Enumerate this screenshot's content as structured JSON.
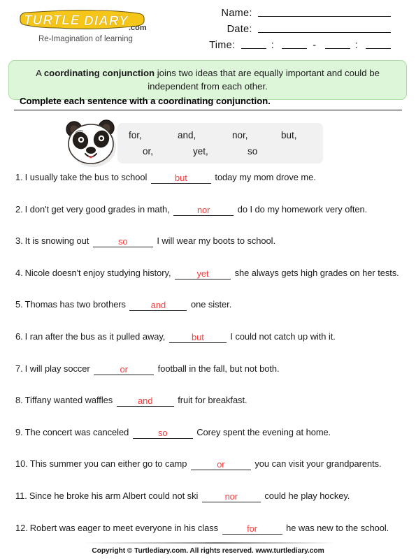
{
  "brand": {
    "logo_line1": "TURTLE",
    "logo_line2": "DIARY",
    "logo_suffix": ".com",
    "tagline": "Re-Imagination of learning",
    "logo_color": "#F5C518",
    "logo_outline": "#3a3a3a"
  },
  "header": {
    "name_label": "Name:",
    "date_label": "Date:",
    "time_label": "Time:",
    "time_colon": ":",
    "time_dash": "-"
  },
  "definition": {
    "prefix": "A ",
    "term": "coordinating conjunction",
    "rest": " joins two ideas that are equally important and could be independent from each other."
  },
  "instruction": {
    "text": "Complete each sentence with a coordinating conjunction."
  },
  "wordbank": {
    "icon": "panda-face-icon",
    "row1": [
      "for,",
      "and,",
      "nor,",
      "but,"
    ],
    "row2": [
      "or,",
      "yet,",
      "so"
    ]
  },
  "answer_color": "#ff3a3a",
  "questions": [
    {
      "num": "1.",
      "before": "I usually take the bus to school",
      "answer": "but",
      "after": "today my mom drove me.",
      "blank_width": 86
    },
    {
      "num": "2.",
      "before": "I don't get very good grades in math,",
      "answer": "nor",
      "after": "do I do my homework very often.",
      "blank_width": 86
    },
    {
      "num": "3.",
      "before": "It is snowing out",
      "answer": "so",
      "after": "I will wear my boots to school.",
      "blank_width": 86
    },
    {
      "num": "4.",
      "before": "Nicole doesn't enjoy studying history,",
      "answer": "yet",
      "after": "she always gets high grades on her tests.",
      "blank_width": 80
    },
    {
      "num": "5.",
      "before": "Thomas has two brothers",
      "answer": "and",
      "after": "one sister.",
      "blank_width": 82
    },
    {
      "num": "6.",
      "before": "I ran after the bus as it pulled away,",
      "answer": "but",
      "after": "I could not catch up with it.",
      "blank_width": 82
    },
    {
      "num": "7.",
      "before": "I will play soccer",
      "answer": "or",
      "after": "football in the fall, but not both.",
      "blank_width": 86
    },
    {
      "num": "8.",
      "before": "Tiffany wanted waffles",
      "answer": "and",
      "after": "fruit for breakfast.",
      "blank_width": 82
    },
    {
      "num": "9.",
      "before": "The concert was canceled",
      "answer": "so",
      "after": "Corey spent the evening at home.",
      "blank_width": 86
    },
    {
      "num": "10.",
      "before": "This summer you can either go to camp",
      "answer": "or",
      "after": "you can visit your grandparents.",
      "blank_width": 86
    },
    {
      "num": "11.",
      "before": "Since he broke his arm Albert could not ski",
      "answer": "nor",
      "after": "could he play hockey.",
      "blank_width": 84
    },
    {
      "num": "12.",
      "before": "Robert was eager to meet everyone in his class",
      "answer": "for",
      "after": "he was new to the school.",
      "blank_width": 86
    }
  ],
  "footer": {
    "text": "Copyright © Turtlediary.com. All rights reserved. www.turtlediary.com"
  }
}
